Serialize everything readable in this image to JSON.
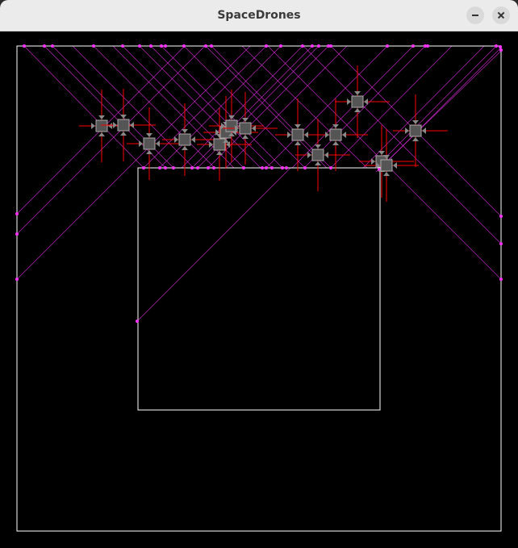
{
  "window": {
    "title": "SpaceDrones"
  },
  "icons": {
    "minimize": "minimize-icon",
    "close": "close-icon"
  },
  "colors": {
    "background": "#000000",
    "boundary": "#ffffff",
    "trajectory": "#ff33ff",
    "thrust": "#ff0000",
    "drone_body": "#555555",
    "drone_outline": "#aaaaaa"
  }
}
